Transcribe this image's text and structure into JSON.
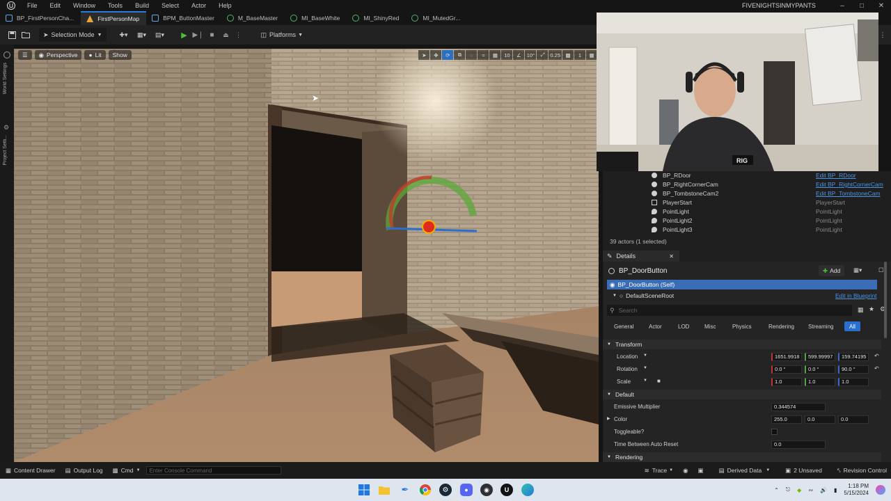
{
  "menubar": {
    "items": [
      "File",
      "Edit",
      "Window",
      "Tools",
      "Build",
      "Select",
      "Actor",
      "Help"
    ],
    "project_title": "FIVENIGHTSINMYPANTS"
  },
  "tabs": [
    {
      "label": "BP_FirstPersonCha...",
      "icon": "person-icon",
      "color": "#6aa5e8"
    },
    {
      "label": "FirstPersonMap",
      "icon": "level-icon",
      "color": "#e8a33a",
      "active": true
    },
    {
      "label": "BPM_ButtonMaster",
      "icon": "blueprint-icon",
      "color": "#6aa5e8"
    },
    {
      "label": "M_BaseMaster",
      "icon": "material-icon",
      "color": "#4db56a"
    },
    {
      "label": "MI_BaseWhite",
      "icon": "material-instance-icon",
      "color": "#4db56a"
    },
    {
      "label": "MI_ShinyRed",
      "icon": "material-instance-icon",
      "color": "#4db56a"
    },
    {
      "label": "MI_MutedGr...",
      "icon": "material-instance-icon",
      "color": "#4db56a"
    }
  ],
  "toolbar": {
    "mode": "Selection Mode",
    "platforms": "Platforms"
  },
  "viewport": {
    "perspective": "Perspective",
    "lit": "Lit",
    "show": "Show",
    "grid_snap": "10",
    "rot_snap": "10°",
    "scale_snap": "0.25",
    "cam_speed": "1"
  },
  "left_rail": {
    "world_settings": "World Settings",
    "project_settings": "Project Setti..."
  },
  "outliner": {
    "rows": [
      {
        "name": "BP_RDoor",
        "type": "Edit BP_RDoor",
        "link": true,
        "icon": "actor-icon"
      },
      {
        "name": "BP_RightCornerCam",
        "type": "Edit BP_RightCornerCam",
        "link": true,
        "icon": "actor-icon"
      },
      {
        "name": "BP_TombstoneCam2",
        "type": "Edit BP_TombstoneCam",
        "link": true,
        "icon": "actor-icon"
      },
      {
        "name": "PlayerStart",
        "type": "PlayerStart",
        "link": false,
        "icon": "player-start-icon"
      },
      {
        "name": "PointLight",
        "type": "PointLight",
        "link": false,
        "icon": "light-icon"
      },
      {
        "name": "PointLight2",
        "type": "PointLight",
        "link": false,
        "icon": "light-icon"
      },
      {
        "name": "PointLight3",
        "type": "PointLight",
        "link": false,
        "icon": "light-icon"
      }
    ],
    "actor_count": "39 actors (1 selected)"
  },
  "details": {
    "tab_label": "Details",
    "actor_name": "BP_DoorButton",
    "add_label": "Add",
    "self_label": "BP_DoorButton (Self)",
    "root_label": "DefaultSceneRoot",
    "edit_blueprint": "Edit in Blueprint",
    "search_placeholder": "Search",
    "categories": [
      "General",
      "Actor",
      "LOD",
      "Misc",
      "Physics",
      "Rendering",
      "Streaming",
      "All"
    ],
    "transform_header": "Transform",
    "location": {
      "label": "Location",
      "x": "1651.9918",
      "y": "599.99997",
      "z": "159.74195"
    },
    "rotation": {
      "label": "Rotation",
      "x": "0.0 °",
      "y": "0.0 °",
      "z": "90.0 °"
    },
    "scale": {
      "label": "Scale",
      "x": "1.0",
      "y": "1.0",
      "z": "1.0"
    },
    "default_header": "Default",
    "emissive": {
      "label": "Emissive Multiplier",
      "value": "0.344574"
    },
    "color": {
      "label": "Color",
      "r": "255.0",
      "g": "0.0",
      "b": "0.0"
    },
    "toggleable": {
      "label": "Toggleable?"
    },
    "time_reset": {
      "label": "Time Between Auto Reset",
      "value": "0.0"
    },
    "rendering_header": "Rendering"
  },
  "statusbar": {
    "content_drawer": "Content Drawer",
    "output_log": "Output Log",
    "cmd": "Cmd",
    "console_placeholder": "Enter Console Command",
    "trace": "Trace",
    "derived_data": "Derived Data",
    "unsaved": "2 Unsaved",
    "revision_control": "Revision Control"
  },
  "taskbar": {
    "time": "1:18 PM",
    "date": "5/15/2024"
  }
}
